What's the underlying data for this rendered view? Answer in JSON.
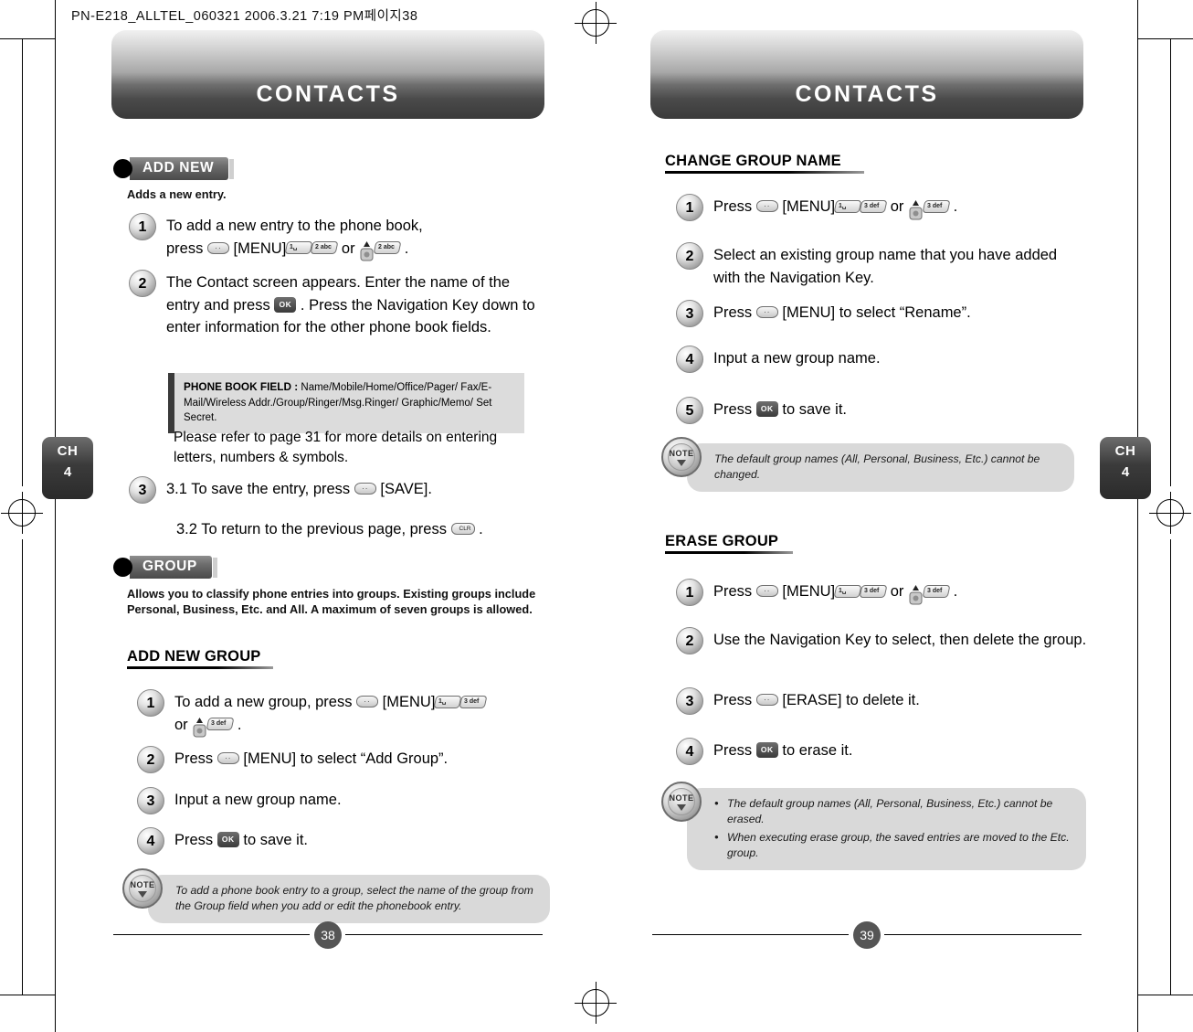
{
  "slug": "PN-E218_ALLTEL_060321  2006.3.21 7:19 PM페이지38",
  "left_page": {
    "banner_title": "CONTACTS",
    "chapter": {
      "line1": "CH",
      "line2": "4"
    },
    "page_number": "38",
    "add_new": {
      "heading": "ADD NEW",
      "description": "Adds a new entry.",
      "steps": [
        {
          "num": "1",
          "text_a": "To add a new entry to the phone book,",
          "text_b": "press",
          "key_menu": "[MENU]",
          "or": "or",
          "end": "."
        },
        {
          "num": "2",
          "text": "The Contact screen appears. Enter the name of the entry and press",
          "text2": ". Press the Navigation Key down to enter information for the other phone book fields."
        }
      ],
      "field_callout": {
        "label": "PHONE BOOK FIELD :",
        "value": "Name/Mobile/Home/Office/Pager/ Fax/E-Mail/Wireless Addr./Group/Ringer/Msg.Ringer/ Graphic/Memo/ Set Secret."
      },
      "note_refer": "Please refer to page 31 for more details on entering letters, numbers & symbols.",
      "step3": {
        "num": "3",
        "text": "3.1 To save the entry, press",
        "save": "[SAVE]."
      },
      "step3b": "3.2 To return to the previous page, press"
    },
    "group": {
      "heading": "GROUP",
      "description": "Allows you to classify phone entries into groups. Existing groups include Personal, Business, Etc. and All. A maximum of seven groups is allowed.",
      "sub_heading": "ADD NEW GROUP",
      "steps": [
        {
          "num": "1",
          "text_a": "To add a new group, press",
          "key_menu": "[MENU]",
          "or": "or",
          "end": "."
        },
        {
          "num": "2",
          "text": "Press",
          "key_menu": "[MENU]",
          "tail": "to select “Add Group”."
        },
        {
          "num": "3",
          "text": "Input a new group name."
        },
        {
          "num": "4",
          "text": "Press",
          "tail": "to save it."
        }
      ],
      "note": "To add a phone book entry to a group, select the name of the group from the Group field when you add or edit the phonebook entry."
    }
  },
  "right_page": {
    "banner_title": "CONTACTS",
    "chapter": {
      "line1": "CH",
      "line2": "4"
    },
    "page_number": "39",
    "change_group_name": {
      "heading": "CHANGE GROUP NAME",
      "steps": [
        {
          "num": "1",
          "text": "Press",
          "key_menu": "[MENU]",
          "or": "or",
          "end": "."
        },
        {
          "num": "2",
          "text": "Select an existing group name that you have added with the Navigation Key."
        },
        {
          "num": "3",
          "text": "Press",
          "key_menu": "[MENU]",
          "tail": "to select “Rename”."
        },
        {
          "num": "4",
          "text": "Input a new group name."
        },
        {
          "num": "5",
          "text": "Press",
          "tail": "to save it."
        }
      ],
      "note": "The default group names (All, Personal, Business, Etc.) cannot be changed."
    },
    "erase_group": {
      "heading": "ERASE GROUP",
      "steps": [
        {
          "num": "1",
          "text": "Press",
          "key_menu": "[MENU]",
          "or": "or",
          "end": "."
        },
        {
          "num": "2",
          "text": "Use the Navigation Key to select, then delete the group."
        },
        {
          "num": "3",
          "text": "Press",
          "key_erase": "[ERASE]",
          "tail": "to delete it."
        },
        {
          "num": "4",
          "text": "Press",
          "tail": "to erase it."
        }
      ],
      "note_items": [
        "The default group names (All, Personal, Business, Etc.) cannot be erased.",
        "When executing erase group, the saved entries are moved to the Etc. group."
      ]
    }
  },
  "keys": {
    "soft_label": "··",
    "ok": "OK",
    "clr": "CLR",
    "num1": "1␣",
    "num2": "2 abc",
    "num3": "3 def",
    "note_word": "NOTE"
  },
  "colors": {
    "banner_dark": "#3a3a3a",
    "note_bg": "#d9d9d9",
    "field_bg": "#dcdcdc"
  }
}
